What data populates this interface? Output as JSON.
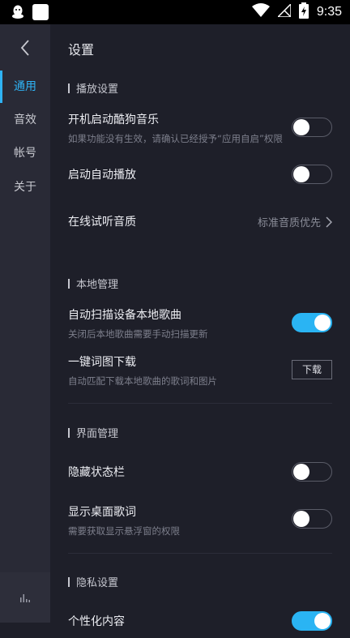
{
  "status_bar": {
    "time": "9:35",
    "icons": [
      "qq-icon",
      "app-icon",
      "wifi-icon",
      "no-signal-icon",
      "battery-charging-icon"
    ]
  },
  "sidebar": {
    "items": [
      {
        "label": "通用",
        "active": true
      },
      {
        "label": "音效",
        "active": false
      },
      {
        "label": "帐号",
        "active": false
      },
      {
        "label": "关于",
        "active": false
      }
    ]
  },
  "page": {
    "title": "设置"
  },
  "sections": {
    "playback": {
      "header": "播放设置",
      "autostart": {
        "title": "开机启动酷狗音乐",
        "subtitle": "如果功能没有生效，请确认已经授予“应用自启”权限",
        "enabled": false
      },
      "autoplay": {
        "title": "启动自动播放",
        "enabled": false
      },
      "quality": {
        "title": "在线试听音质",
        "value": "标准音质优先"
      }
    },
    "local": {
      "header": "本地管理",
      "autoscan": {
        "title": "自动扫描设备本地歌曲",
        "subtitle": "关闭后本地歌曲需要手动扫描更新",
        "enabled": true
      },
      "lyrics_download": {
        "title": "一键词图下载",
        "subtitle": "自动匹配下载本地歌曲的歌词和图片",
        "button": "下载"
      }
    },
    "ui": {
      "header": "界面管理",
      "hide_statusbar": {
        "title": "隐藏状态栏",
        "enabled": false
      },
      "desktop_lyrics": {
        "title": "显示桌面歌词",
        "subtitle": "需要获取显示悬浮窗的权限",
        "enabled": false
      }
    },
    "privacy": {
      "header": "隐私设置",
      "personalized": {
        "title": "个性化内容",
        "enabled": true
      }
    }
  },
  "colors": {
    "accent": "#2ab4f3",
    "background": "#1e1f29",
    "sidebar": "#292a36"
  }
}
